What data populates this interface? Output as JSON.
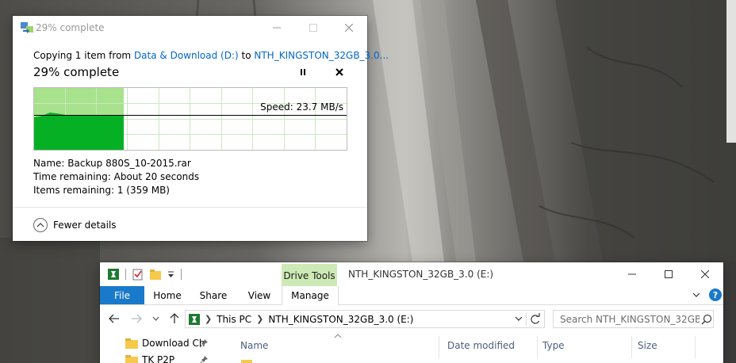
{
  "copy_dialog": {
    "title": "29% complete",
    "copy_prefix": "Copying 1 item from ",
    "source": "Data & Download (D:)",
    "to_word": " to ",
    "destination": "NTH_KINGSTON_32GB_3.0...",
    "heading": "29% complete",
    "progress_percent": 29,
    "speed_label": "Speed: 23.7 MB/s",
    "name_label": "Name:",
    "name_value": "Backup 880S_10-2015.rar",
    "time_label": "Time remaining:",
    "time_value": "About 20 seconds",
    "items_label": "Items remaining:",
    "items_value": "1 (359 MB)",
    "fewer_details": "Fewer details",
    "colors": {
      "progress_fill": "#06b025",
      "progress_bg": "#a8e28c",
      "link": "#0066cc"
    }
  },
  "explorer": {
    "title": "NTH_KINGSTON_32GB_3.0 (E:)",
    "contextual_tab": "Drive Tools",
    "tabs": [
      "File",
      "Home",
      "Share",
      "View",
      "Manage"
    ],
    "address": [
      "This PC",
      "NTH_KINGSTON_32GB_3.0 (E:)"
    ],
    "search_placeholder": "Search NTH_KINGSTON_32GB...",
    "nav_items": [
      "Download Ch",
      "TK P2P"
    ],
    "columns": [
      "Name",
      "Date modified",
      "Type",
      "Size"
    ],
    "colors": {
      "file_tab": "#1979ca",
      "drive_tools": "#cdeab6"
    }
  },
  "icons": {
    "copy": "copy-arrow-icon",
    "pause": "pause-icon",
    "stop": "stop-icon",
    "expand": "chevron-up-icon",
    "drive": "usb-drive-icon",
    "properties": "properties-icon",
    "new_folder": "new-folder-icon",
    "qa_dropdown": "dropdown-icon",
    "back": "back-arrow-icon",
    "forward": "forward-arrow-icon",
    "up": "up-arrow-icon",
    "refresh": "refresh-icon",
    "search": "search-icon",
    "pin": "pin-icon",
    "folder": "folder-icon",
    "help": "help-icon"
  }
}
